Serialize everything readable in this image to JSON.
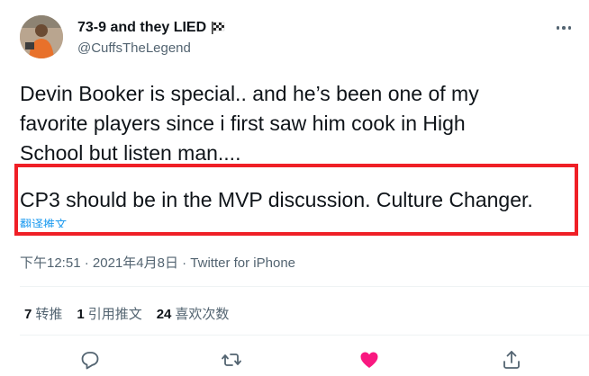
{
  "author": {
    "display_name": "73-9 and they LIED",
    "handle": "@CuffsTheLegend",
    "flag_icon": "checkered-flag-icon"
  },
  "tweet": {
    "paragraph1_lines": [
      "Devin Booker is special.. and he’s been one of my",
      "favorite players since i first saw him cook in High",
      "School but listen man...."
    ],
    "paragraph2": "CP3 should be in the MVP discussion. Culture Changer.",
    "translate_label": "翻译推文",
    "highlight_color": "#ef1f26"
  },
  "meta": {
    "time": "下午12:51",
    "separator": " · ",
    "date": "2021年4月8日",
    "source": "Twitter for iPhone"
  },
  "stats": {
    "retweets_count": "7",
    "retweets_label": "转推",
    "quotes_count": "1",
    "quotes_label": "引用推文",
    "likes_count": "24",
    "likes_label": "喜欢次数"
  },
  "actions": {
    "reply_icon": "reply-icon",
    "retweet_icon": "retweet-icon",
    "like_icon": "heart-icon",
    "like_color": "#f91880",
    "share_icon": "share-icon"
  }
}
